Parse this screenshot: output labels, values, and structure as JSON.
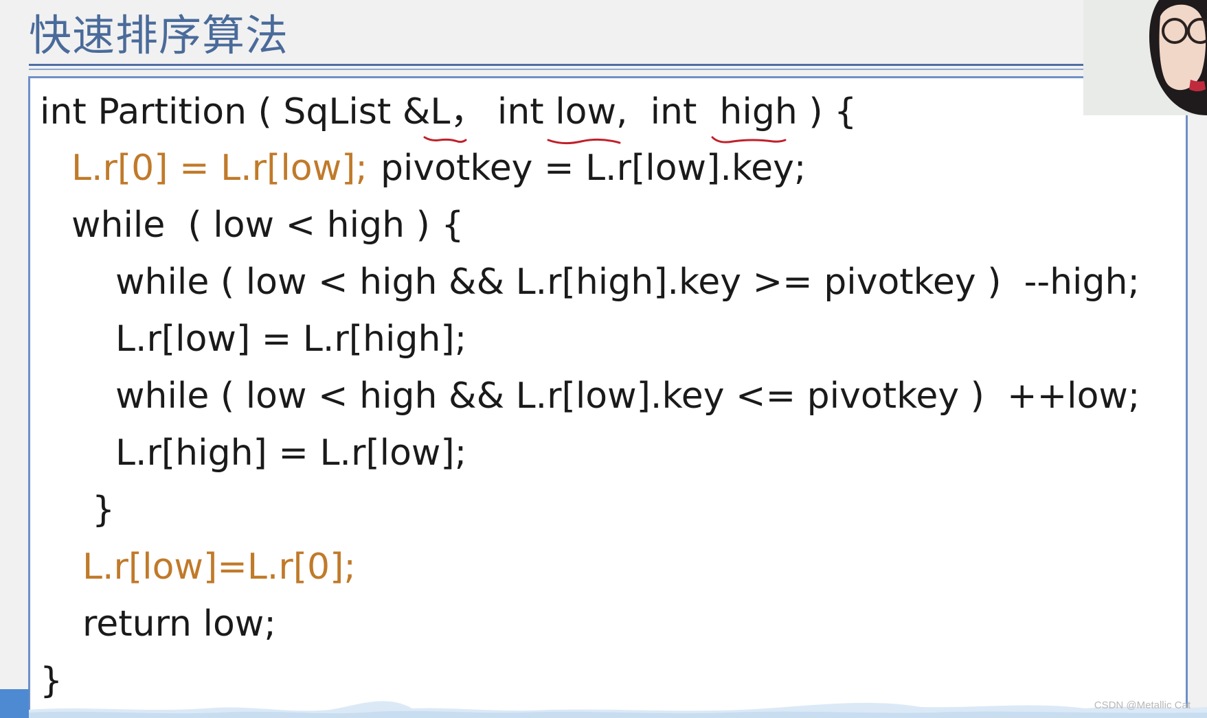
{
  "slide": {
    "title": "快速排序算法"
  },
  "code": {
    "lines": [
      "int Partition ( SqList &L， int low,  int  high ) {",
      "L.r[0] = L.r[low];",
      "pivotkey = L.r[low].key;",
      "while  ( low < high ) {",
      "while ( low < high && L.r[high].key >= pivotkey )  --high;",
      "L.r[low] = L.r[high];",
      "while ( low < high && L.r[low].key <= pivotkey )  ++low;",
      "L.r[high] = L.r[low];",
      "}",
      "L.r[low]=L.r[0];",
      "return low;",
      "}"
    ]
  },
  "watermark": {
    "text": "CSDN @Metallic Cat"
  },
  "colors": {
    "title": "#4a6b9a",
    "rule": "#4f6ea3",
    "code_border": "#6f8fc6",
    "code_text": "#1a1a1a",
    "code_highlight": "#c07a2a",
    "ink_underline": "#c0202a"
  }
}
